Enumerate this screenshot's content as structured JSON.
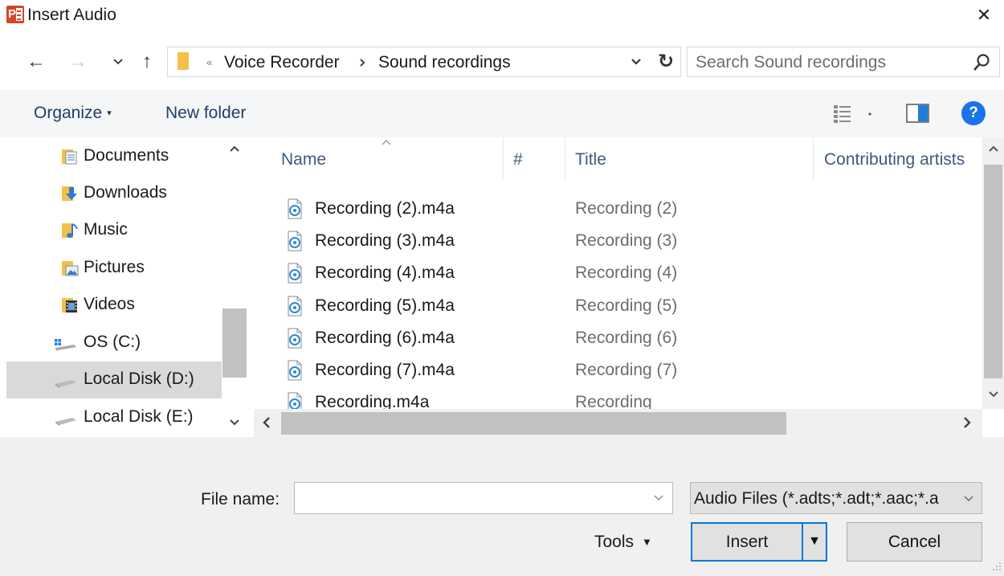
{
  "window": {
    "title": "Insert Audio",
    "app_icon": "powerpoint-icon",
    "close_icon": "close-icon",
    "close_glyph": "✕"
  },
  "nav": {
    "back_glyph": "←",
    "forward_glyph": "→",
    "recent_glyph": "⌄",
    "up_glyph": "↑"
  },
  "address": {
    "overflow": "«",
    "crumbs": [
      "Voice Recorder",
      "Sound recordings"
    ],
    "separator": "›",
    "dropdown_glyph": "⌄",
    "refresh_glyph": "↻"
  },
  "search": {
    "placeholder": "Search Sound recordings",
    "icon": "search-icon"
  },
  "toolbar": {
    "organize_label": "Organize",
    "organize_dd": "▾",
    "new_folder_label": "New folder",
    "help_glyph": "?"
  },
  "sidebar": {
    "items": [
      {
        "label": "Documents",
        "icon": "documents-icon"
      },
      {
        "label": "Downloads",
        "icon": "downloads-icon"
      },
      {
        "label": "Music",
        "icon": "music-icon"
      },
      {
        "label": "Pictures",
        "icon": "pictures-icon"
      },
      {
        "label": "Videos",
        "icon": "videos-icon"
      },
      {
        "label": "OS (C:)",
        "icon": "os-drive-icon"
      },
      {
        "label": "Local Disk (D:)",
        "icon": "disk-drive-icon",
        "selected": true
      },
      {
        "label": "Local Disk (E:)",
        "icon": "disk-drive-icon"
      }
    ]
  },
  "file_list": {
    "columns": [
      "Name",
      "#",
      "Title",
      "Contributing artists"
    ],
    "files": [
      {
        "name": "Recording (2).m4a",
        "title": "Recording (2)"
      },
      {
        "name": "Recording (3).m4a",
        "title": "Recording (3)"
      },
      {
        "name": "Recording (4).m4a",
        "title": "Recording (4)"
      },
      {
        "name": "Recording (5).m4a",
        "title": "Recording (5)"
      },
      {
        "name": "Recording (6).m4a",
        "title": "Recording (6)"
      },
      {
        "name": "Recording (7).m4a",
        "title": "Recording (7)"
      },
      {
        "name": "Recording.m4a",
        "title": "Recording"
      }
    ],
    "file_icon": "audio-file-icon"
  },
  "footer": {
    "file_name_label": "File name:",
    "file_name_value": "",
    "file_type": "Audio Files (*.adts;*.adt;*.aac;*.a",
    "tools_label": "Tools",
    "tools_dd": "▼",
    "insert_label": "Insert",
    "insert_dd": "▼",
    "cancel_label": "Cancel"
  },
  "colors": {
    "accent": "#0078d7",
    "help": "#1a73e8",
    "powerpoint": "#d24726",
    "folder": "#f3c14b"
  }
}
